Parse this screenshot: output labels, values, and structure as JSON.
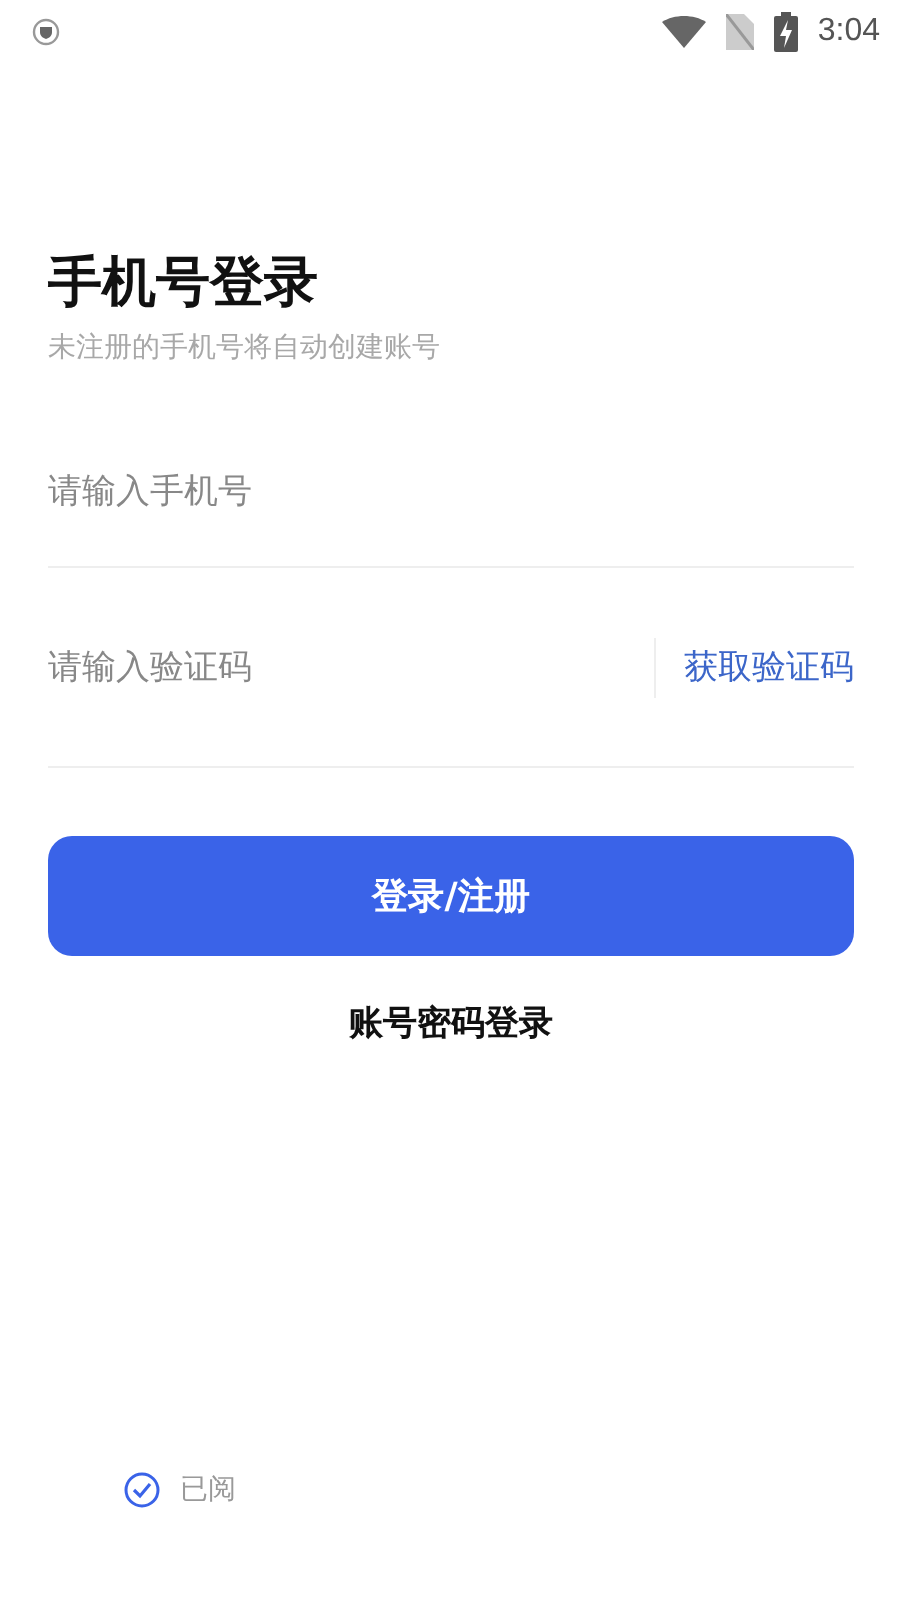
{
  "status_bar": {
    "time": "3:04"
  },
  "title": "手机号登录",
  "subtitle": "未注册的手机号将自动创建账号",
  "phone_field": {
    "placeholder": "请输入手机号"
  },
  "code_field": {
    "placeholder": "请输入验证码",
    "action": "获取验证码"
  },
  "login_button": "登录/注册",
  "password_login": "账号密码登录",
  "agreement": {
    "checked": true,
    "text": "已阅"
  }
}
